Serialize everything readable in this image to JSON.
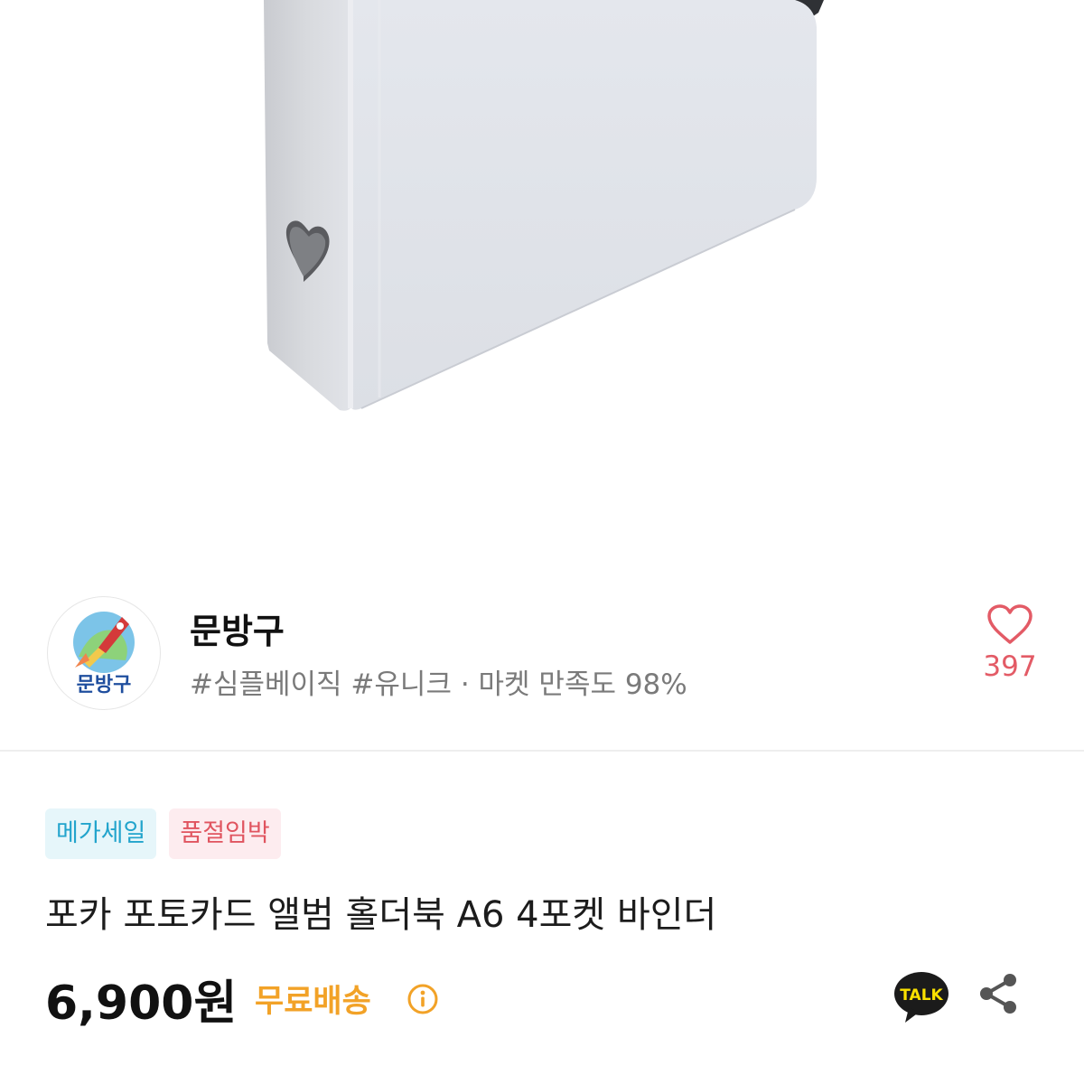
{
  "seller": {
    "name": "문방구",
    "avatar_text": "문방구",
    "meta": "#심플베이직 #유니크 · 마켓 만족도 98%"
  },
  "likes": {
    "count": "397"
  },
  "badges": [
    {
      "label": "메가세일"
    },
    {
      "label": "품절임박"
    }
  ],
  "product": {
    "title": "포카 포토카드 앨범 홀더북 A6 4포켓 바인더",
    "price": "6,900원",
    "shipping": "무료배송"
  },
  "icons": {
    "heart": "heart-icon",
    "info": "info-icon",
    "talk": "kakao-talk-icon",
    "talk_label": "TALK",
    "share": "share-icon"
  },
  "colors": {
    "like_red": "#e35b66",
    "shipping_orange": "#f2a227",
    "badge_blue": "#22a4cc",
    "badge_red": "#e0545f",
    "binder_gray": "#dfe2e8"
  }
}
